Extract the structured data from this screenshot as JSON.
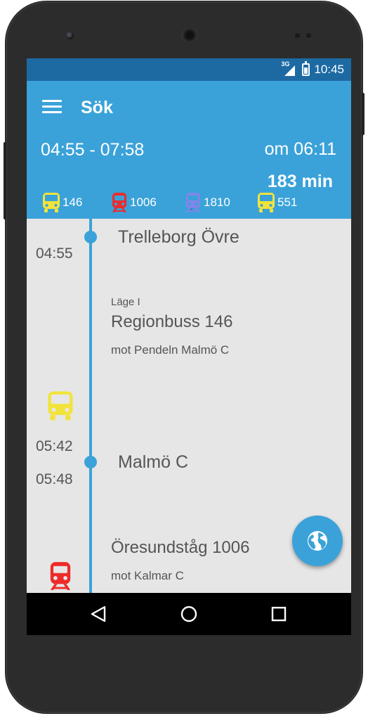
{
  "status_bar": {
    "network": "3G",
    "time": "10:45"
  },
  "app_bar": {
    "title": "Sök"
  },
  "trip": {
    "time_range": "04:55 - 07:58",
    "departs_in": "om 06:11",
    "duration": "183 min",
    "legs": [
      {
        "icon": "bus-icon",
        "color": "#f2e33b",
        "number": "146"
      },
      {
        "icon": "train-icon",
        "color": "#ee2b2b",
        "number": "1006"
      },
      {
        "icon": "train-icon",
        "color": "#7f86e8",
        "number": "1810"
      },
      {
        "icon": "bus-icon",
        "color": "#f2e33b",
        "number": "551"
      }
    ]
  },
  "itinerary": {
    "stop1": {
      "name": "Trelleborg Övre",
      "departure": "04:55"
    },
    "leg1": {
      "position": "Läge I",
      "route": "Regionbuss 146",
      "direction": "mot Pendeln Malmö C",
      "icon": "bus-icon",
      "color": "#f2e33b"
    },
    "stop2": {
      "name": "Malmö C",
      "arrival": "05:42",
      "departure": "05:48"
    },
    "leg2": {
      "route": "Öresundståg 1006",
      "direction": "mot Kalmar C",
      "icon": "train-icon",
      "color": "#ee2b2b"
    }
  },
  "fab": {
    "icon": "globe-icon"
  },
  "colors": {
    "accent": "#3aa2d9",
    "status_bar": "#1d6aa3",
    "bus": "#f2e33b",
    "train_red": "#ee2b2b",
    "train_blue": "#7f86e8"
  }
}
